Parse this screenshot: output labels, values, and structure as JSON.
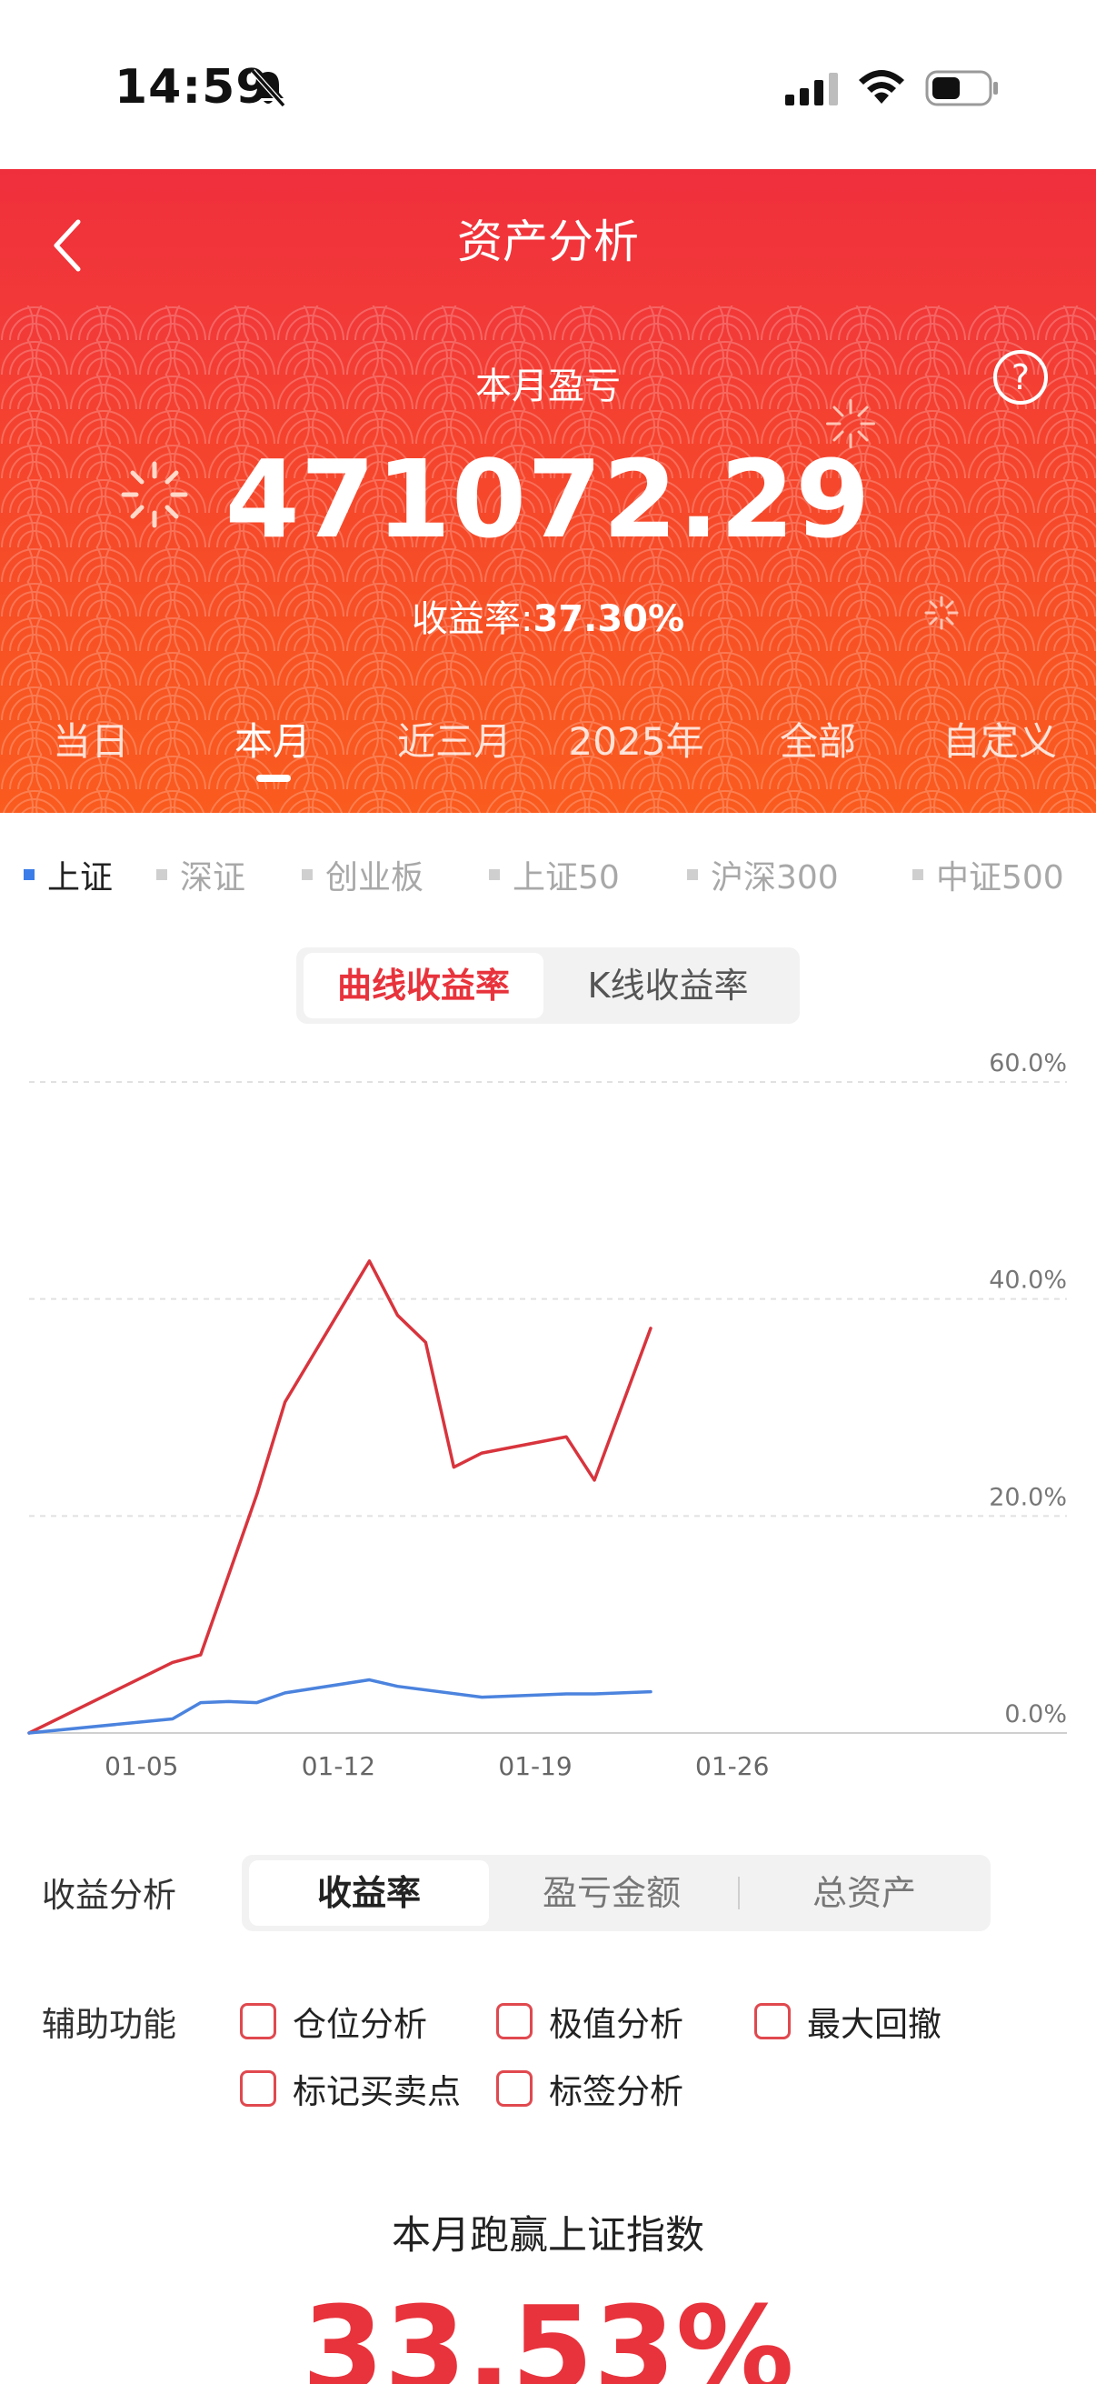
{
  "status_bar": {
    "time": "14:59"
  },
  "header": {
    "title": "资产分析",
    "month_label": "本月盈亏",
    "profit_value": "471072.29",
    "yield_label": "收益率:",
    "yield_value": "37.30%"
  },
  "period_tabs": [
    {
      "label": "当日"
    },
    {
      "label": "本月"
    },
    {
      "label": "近三月"
    },
    {
      "label": "2025年"
    },
    {
      "label": "全部"
    },
    {
      "label": "自定义"
    }
  ],
  "active_period": "本月",
  "index_tabs": [
    {
      "label": "上证"
    },
    {
      "label": "深证"
    },
    {
      "label": "创业板"
    },
    {
      "label": "上证50"
    },
    {
      "label": "沪深300"
    },
    {
      "label": "中证500"
    }
  ],
  "active_index": "上证",
  "chart_type_tabs": {
    "curve": "曲线收益率",
    "kline": "K线收益率"
  },
  "chart_data": {
    "type": "line",
    "y_ticks": [
      "60.0%",
      "40.0%",
      "20.0%",
      "0.0%"
    ],
    "x_ticks": [
      "01-05",
      "01-12",
      "01-19",
      "01-26"
    ],
    "ylim": [
      0,
      60
    ],
    "y_unit": "%",
    "x_dates": [
      "01-01",
      "01-02",
      "01-03",
      "01-04",
      "01-05",
      "01-06",
      "01-07",
      "01-08",
      "01-09",
      "01-10",
      "01-11",
      "01-12",
      "01-13",
      "01-14",
      "01-15",
      "01-16",
      "01-17",
      "01-18",
      "01-19",
      "01-20",
      "01-21",
      "01-22",
      "01-23",
      "01-24",
      "01-25",
      "01-26",
      "01-27",
      "01-28",
      "01-29",
      "01-30",
      "01-31"
    ],
    "x_ratio": 0.1436,
    "series": [
      {
        "color": "#d8343d",
        "points": [
          [
            0,
            0
          ],
          [
            5.1,
            6.5
          ],
          [
            6.1,
            7.2
          ],
          [
            8.1,
            22
          ],
          [
            9.1,
            30.5
          ],
          [
            12.1,
            43.5
          ],
          [
            13.1,
            38.5
          ],
          [
            14.1,
            36
          ],
          [
            15.1,
            24.5
          ],
          [
            16.1,
            25.8
          ],
          [
            19.1,
            27.3
          ],
          [
            20.1,
            23.3
          ],
          [
            22.1,
            37.3
          ]
        ]
      },
      {
        "color": "#4b83de",
        "points": [
          [
            0,
            0
          ],
          [
            5.1,
            1.3
          ],
          [
            6.1,
            2.8
          ],
          [
            7.1,
            2.9
          ],
          [
            8.1,
            2.8
          ],
          [
            9.1,
            3.7
          ],
          [
            12.1,
            4.9
          ],
          [
            13.1,
            4.3
          ],
          [
            16.1,
            3.3
          ],
          [
            19.1,
            3.6
          ],
          [
            20.1,
            3.6
          ],
          [
            22.1,
            3.8
          ]
        ]
      }
    ]
  },
  "analysis": {
    "label": "收益分析",
    "tabs": [
      {
        "label": "收益率"
      },
      {
        "label": "盈亏金额"
      },
      {
        "label": "总资产"
      }
    ]
  },
  "auxiliary": {
    "label": "辅助功能",
    "options": [
      {
        "label": "仓位分析"
      },
      {
        "label": "极值分析"
      },
      {
        "label": "最大回撤"
      },
      {
        "label": "标记买卖点"
      },
      {
        "label": "标签分析"
      }
    ]
  },
  "beat": {
    "title": "本月跑赢上证指数",
    "value": "33.53%"
  },
  "colors": {
    "brand_red": "#f0323c",
    "orange": "#f85a1f",
    "blue": "#3b7de8"
  }
}
